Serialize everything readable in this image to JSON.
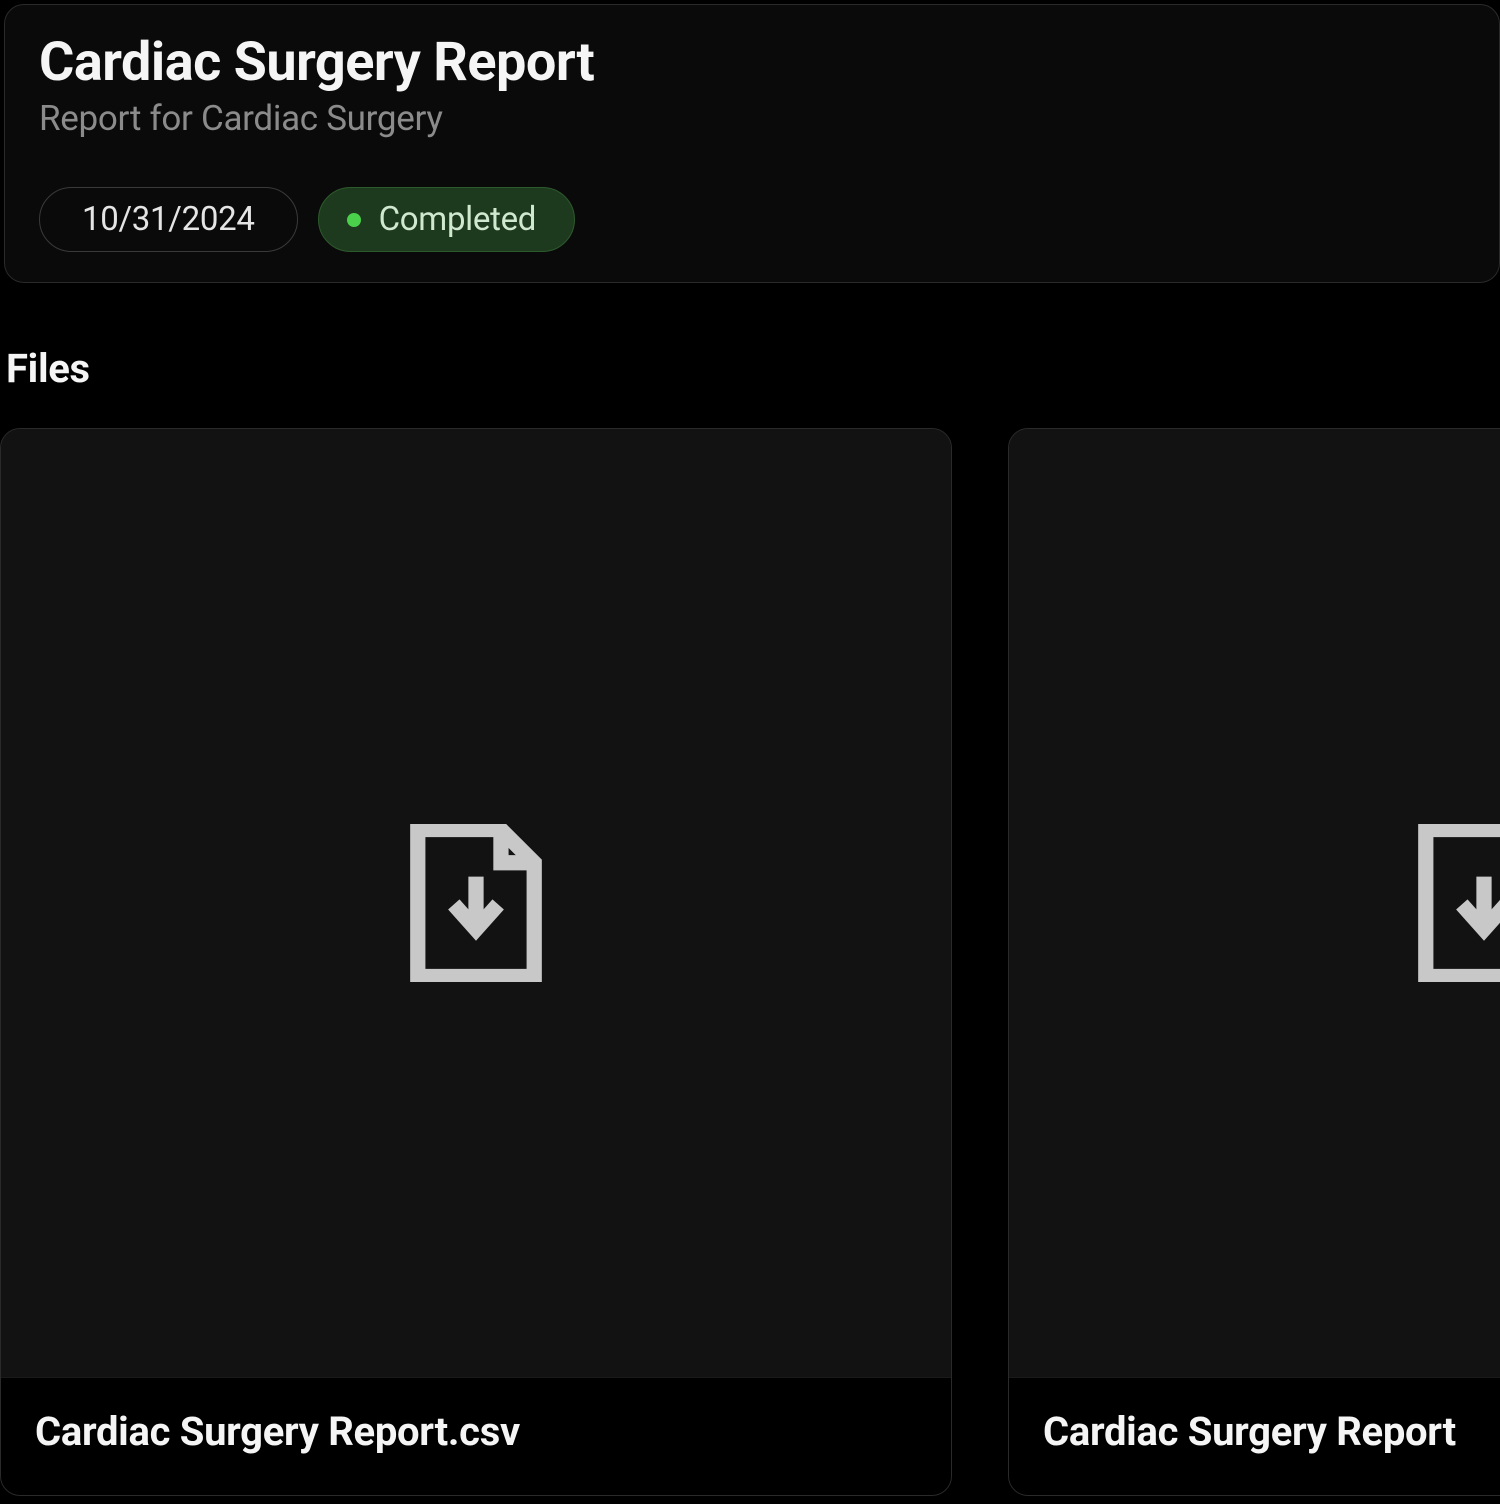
{
  "header": {
    "title": "Cardiac Surgery Report",
    "subtitle": "Report for Cardiac Surgery",
    "date": "10/31/2024",
    "status": "Completed"
  },
  "files": {
    "section_label": "Files",
    "items": [
      {
        "name": "Cardiac Surgery Report.csv"
      },
      {
        "name": "Cardiac Surgery Report"
      }
    ]
  },
  "colors": {
    "status_dot": "#4bd04b",
    "status_bg": "#1e3a1e"
  }
}
